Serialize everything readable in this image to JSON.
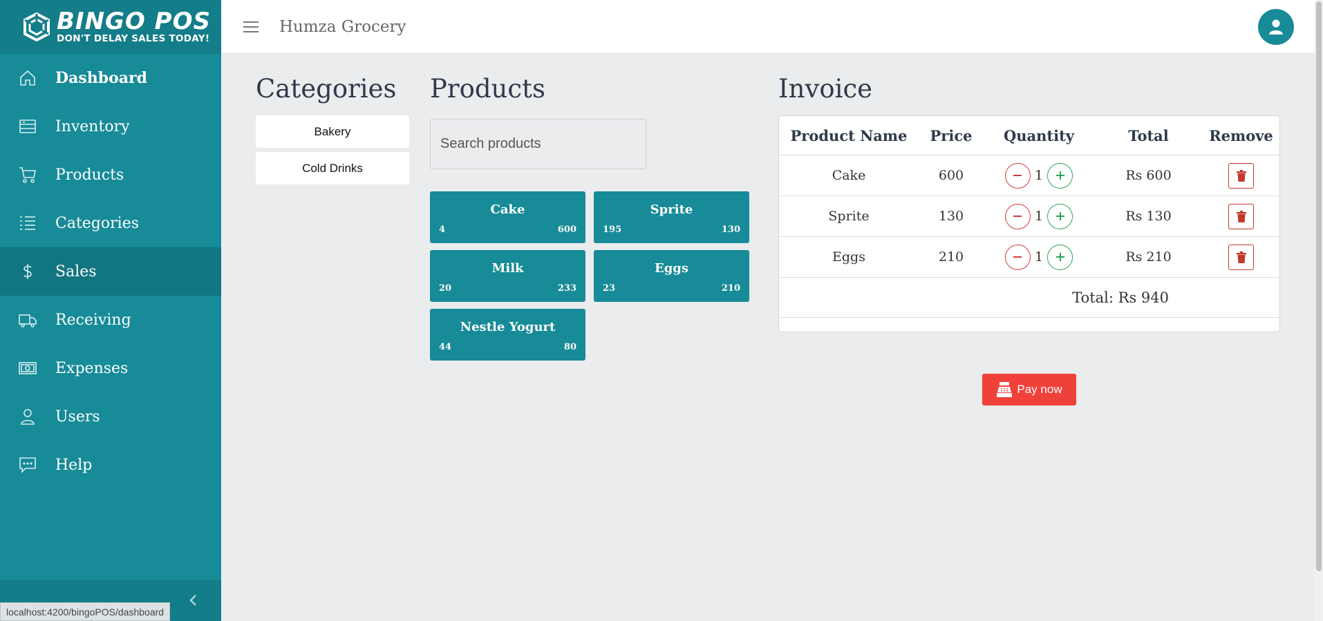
{
  "brand": {
    "name": "BINGO POS",
    "tagline": "DON'T DELAY SALES TODAY!"
  },
  "sidebar": {
    "items": [
      {
        "label": "Dashboard",
        "icon": "home-icon"
      },
      {
        "label": "Inventory",
        "icon": "inventory-icon"
      },
      {
        "label": "Products",
        "icon": "cart-icon"
      },
      {
        "label": "Categories",
        "icon": "list-icon"
      },
      {
        "label": "Sales",
        "icon": "dollar-icon",
        "active": true
      },
      {
        "label": "Receiving",
        "icon": "truck-icon"
      },
      {
        "label": "Expenses",
        "icon": "money-icon"
      },
      {
        "label": "Users",
        "icon": "user-icon"
      },
      {
        "label": "Help",
        "icon": "chat-icon"
      }
    ],
    "status_url": "localhost:4200/bingoPOS/dashboard"
  },
  "header": {
    "store_name": "Humza Grocery"
  },
  "categories": {
    "title": "Categories",
    "items": [
      "Bakery",
      "Cold Drinks"
    ]
  },
  "products": {
    "title": "Products",
    "search_placeholder": "Search products",
    "items": [
      {
        "name": "Cake",
        "stock": "4",
        "price": "600"
      },
      {
        "name": "Sprite",
        "stock": "195",
        "price": "130"
      },
      {
        "name": "Milk",
        "stock": "20",
        "price": "233"
      },
      {
        "name": "Eggs",
        "stock": "23",
        "price": "210"
      },
      {
        "name": "Nestle Yogurt",
        "stock": "44",
        "price": "80"
      }
    ]
  },
  "invoice": {
    "title": "Invoice",
    "columns": [
      "Product Name",
      "Price",
      "Quantity",
      "Total",
      "Remove"
    ],
    "rows": [
      {
        "name": "Cake",
        "price": "600",
        "qty": "1",
        "total": "Rs 600"
      },
      {
        "name": "Sprite",
        "price": "130",
        "qty": "1",
        "total": "Rs 130"
      },
      {
        "name": "Eggs",
        "price": "210",
        "qty": "1",
        "total": "Rs 210"
      }
    ],
    "total": "Total: Rs 940",
    "pay_label": "Pay now"
  },
  "colors": {
    "primary": "#178b98",
    "sidebar_active": "#127582",
    "pay": "#f0403a",
    "minus": "#d23b3b",
    "plus": "#2aa653",
    "delete": "#c0392b"
  }
}
